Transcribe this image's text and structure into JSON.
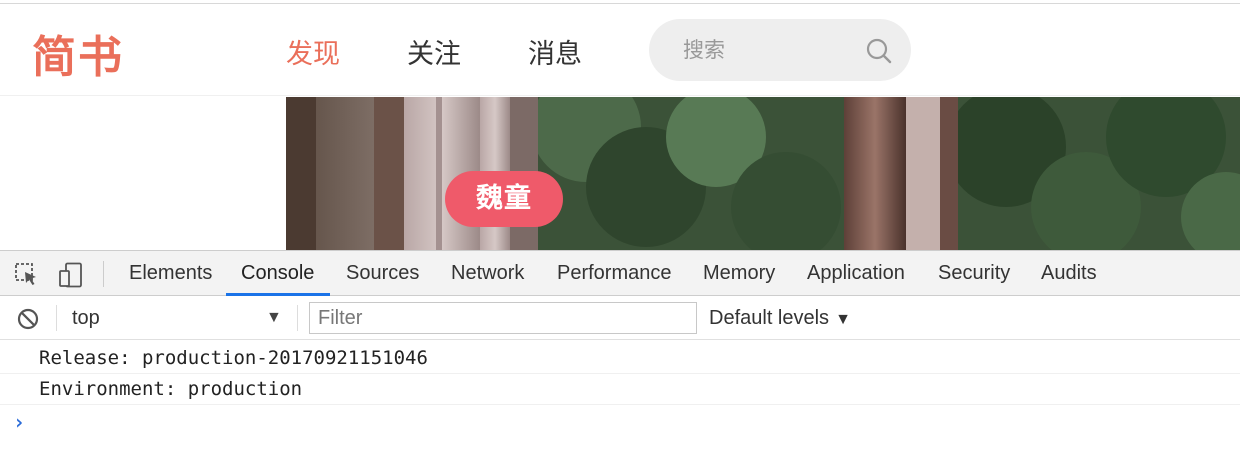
{
  "site": {
    "logo": "简书",
    "nav": [
      {
        "label": "发现",
        "active": true
      },
      {
        "label": "关注",
        "active": false
      },
      {
        "label": "消息",
        "active": false
      }
    ],
    "search": {
      "placeholder": "搜索",
      "icon": "search-icon"
    },
    "accent_color": "#ea6f5a"
  },
  "banner": {
    "author_label": "魏童",
    "pill_color": "#ef5a6a"
  },
  "devtools": {
    "tool_icons": [
      "inspect-element-icon",
      "device-toolbar-icon"
    ],
    "tabs": [
      {
        "label": "Elements"
      },
      {
        "label": "Console",
        "active": true
      },
      {
        "label": "Sources"
      },
      {
        "label": "Network"
      },
      {
        "label": "Performance"
      },
      {
        "label": "Memory"
      },
      {
        "label": "Application"
      },
      {
        "label": "Security"
      },
      {
        "label": "Audits"
      }
    ],
    "filterbar": {
      "clear_icon": "clear-console-icon",
      "context": "top",
      "context_arrow": "▼",
      "filter_placeholder": "Filter",
      "levels": "Default levels",
      "levels_arrow": "▼"
    },
    "console": {
      "lines": [
        "Release: production-20170921151046",
        "Environment: production"
      ],
      "prompt": "›"
    },
    "active_tab_color": "#1a73e8"
  }
}
